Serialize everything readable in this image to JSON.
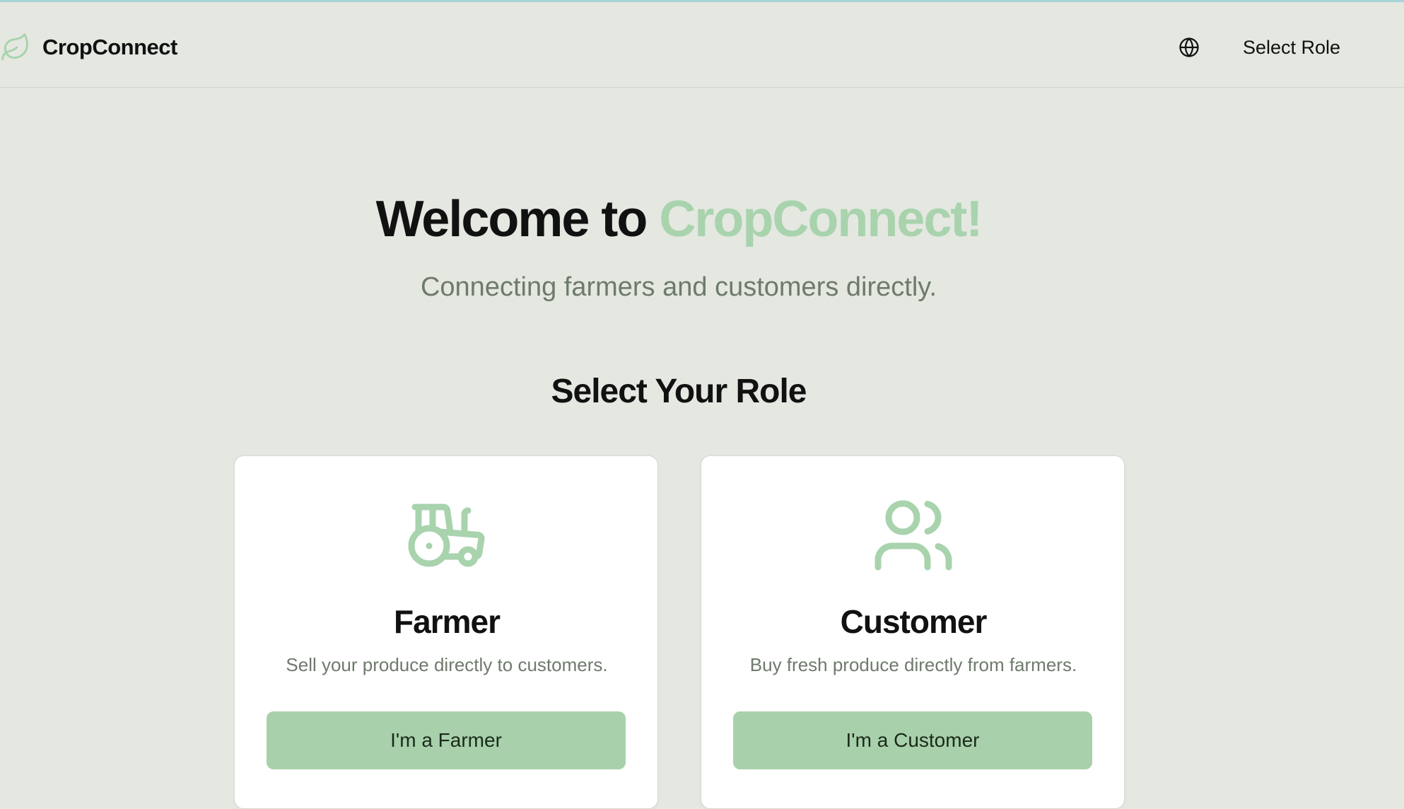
{
  "app": {
    "brand_name": "CropConnect",
    "accent_color": "#a8d3ad",
    "background_color": "#e4e8e1"
  },
  "navbar": {
    "brand_icon": "leaf-icon",
    "language_icon": "globe-icon",
    "select_role_label": "Select Role"
  },
  "hero": {
    "title_prefix": "Welcome to",
    "title_highlight": "CropConnect!",
    "subtitle": "Connecting farmers and customers directly."
  },
  "roles": {
    "heading": "Select Your Role",
    "cards": [
      {
        "icon": "tractor-icon",
        "title": "Farmer",
        "description": "Sell your produce directly to customers.",
        "button_label": "I'm a Farmer"
      },
      {
        "icon": "users-icon",
        "title": "Customer",
        "description": "Buy fresh produce directly from farmers.",
        "button_label": "I'm a Customer"
      }
    ]
  }
}
